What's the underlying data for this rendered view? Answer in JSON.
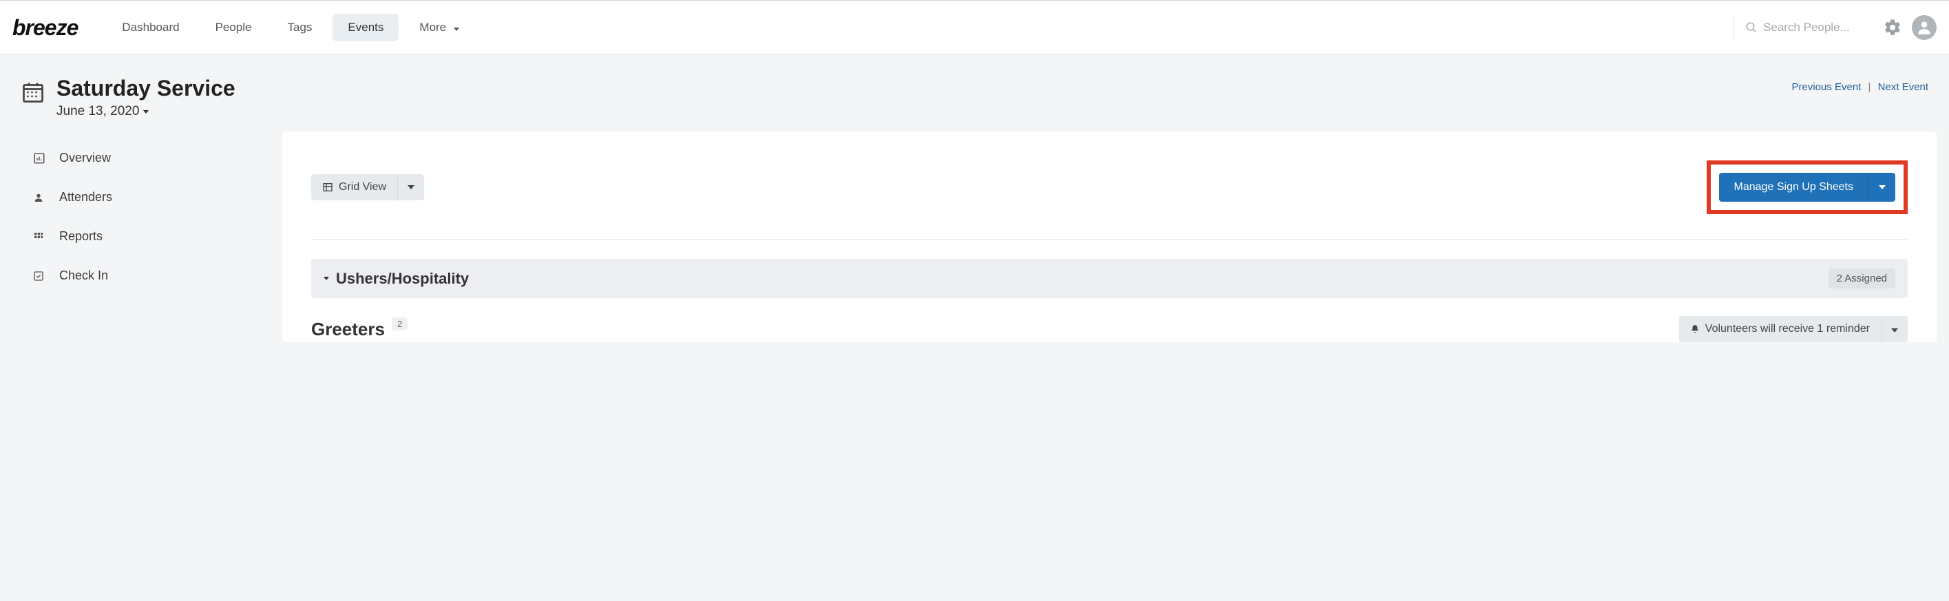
{
  "brand": "breeze",
  "nav": {
    "items": [
      {
        "label": "Dashboard"
      },
      {
        "label": "People"
      },
      {
        "label": "Tags"
      },
      {
        "label": "Events"
      },
      {
        "label": "More"
      }
    ],
    "active_index": 3,
    "search_placeholder": "Search People..."
  },
  "header": {
    "title": "Saturday Service",
    "date": "June 13, 2020",
    "prev_label": "Previous Event",
    "next_label": "Next Event"
  },
  "sidebar": {
    "items": [
      {
        "label": "Overview",
        "icon": "chart-bar"
      },
      {
        "label": "Attenders",
        "icon": "user"
      },
      {
        "label": "Reports",
        "icon": "grid"
      },
      {
        "label": "Check In",
        "icon": "check-square"
      }
    ]
  },
  "toolbar": {
    "grid_view_label": "Grid View",
    "manage_label": "Manage Sign Up Sheets"
  },
  "section": {
    "title": "Ushers/Hospitality",
    "assigned_badge": "2 Assigned"
  },
  "sub": {
    "title": "Greeters",
    "count": "2",
    "reminder_label": "Volunteers will receive 1 reminder"
  }
}
